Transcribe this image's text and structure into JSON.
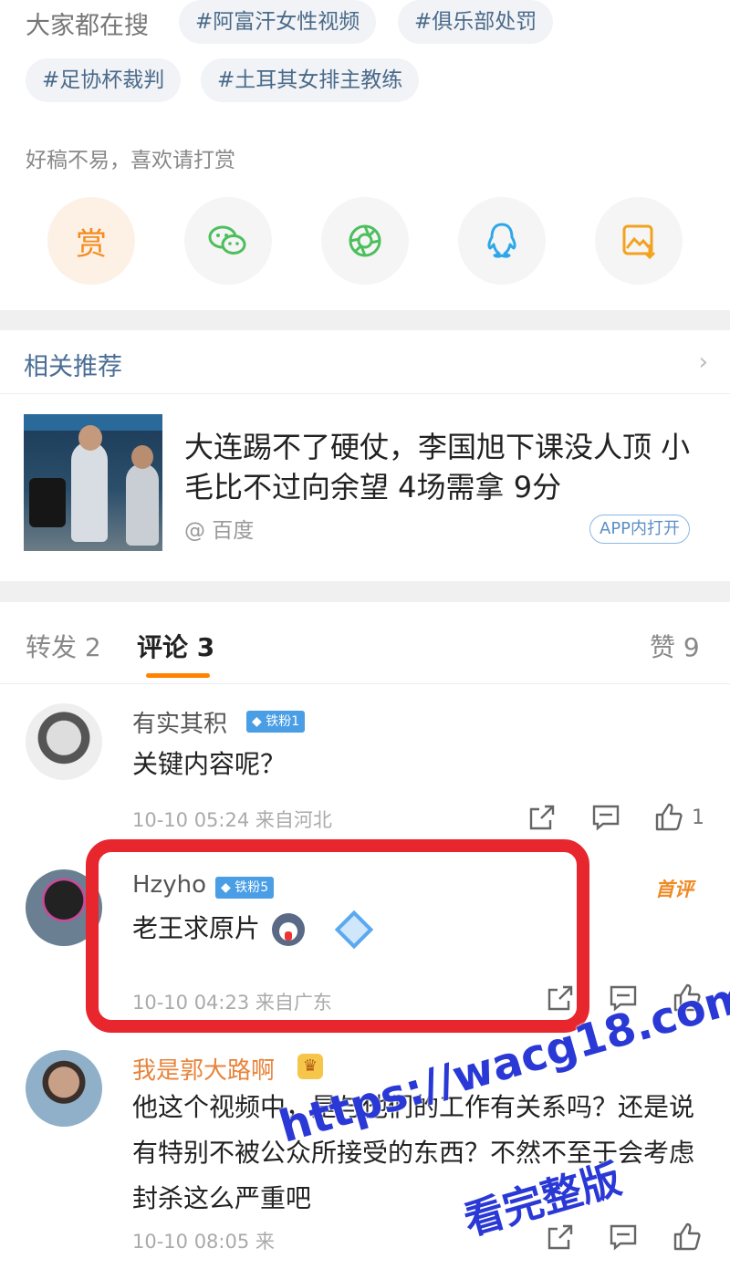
{
  "hot_search": {
    "label": "大家都在搜",
    "tags": [
      "#阿富汗女性视频",
      "#俱乐部处罚",
      "#足协杯裁判",
      "#土耳其女排主教练"
    ]
  },
  "reward": {
    "prompt": "好稿不易，喜欢请打赏",
    "reward_label": "赏",
    "share_icons": [
      "wechat-icon",
      "moments-icon",
      "qq-icon",
      "save-image-icon"
    ]
  },
  "related": {
    "title": "相关推荐",
    "article_title": "大连踢不了硬仗，李国旭下课没人顶 小毛比不过向余望 4场需拿 9分",
    "source": "@ 百度",
    "open_app": "APP内打开"
  },
  "tabs": {
    "repost": "转发 2",
    "comments": "评论 3",
    "likes": "赞 9"
  },
  "comments": [
    {
      "user": "有实其积",
      "badge": "铁粉1",
      "text": "关键内容呢？",
      "meta": "10-10 05:24  来自河北",
      "likes": "1"
    },
    {
      "user": "Hzyho",
      "badge": "铁粉5",
      "text": "老王求原片",
      "meta": "10-10 04:23  来自广东",
      "first": "首评"
    },
    {
      "user": "我是郭大路啊",
      "text": "他这个视频中，是与他们的工作有关系吗？还是说有特别不被公众所接受的东西？不然不至于会考虑封杀这么严重吧",
      "meta": "10-10 08:05  来"
    }
  ],
  "watermark": {
    "line1": "https://wacg18.com",
    "line2": "看完整版"
  },
  "colors": {
    "accent": "#ff8200",
    "link_blue": "#4a6d95",
    "highlight_red": "#e8262e"
  }
}
